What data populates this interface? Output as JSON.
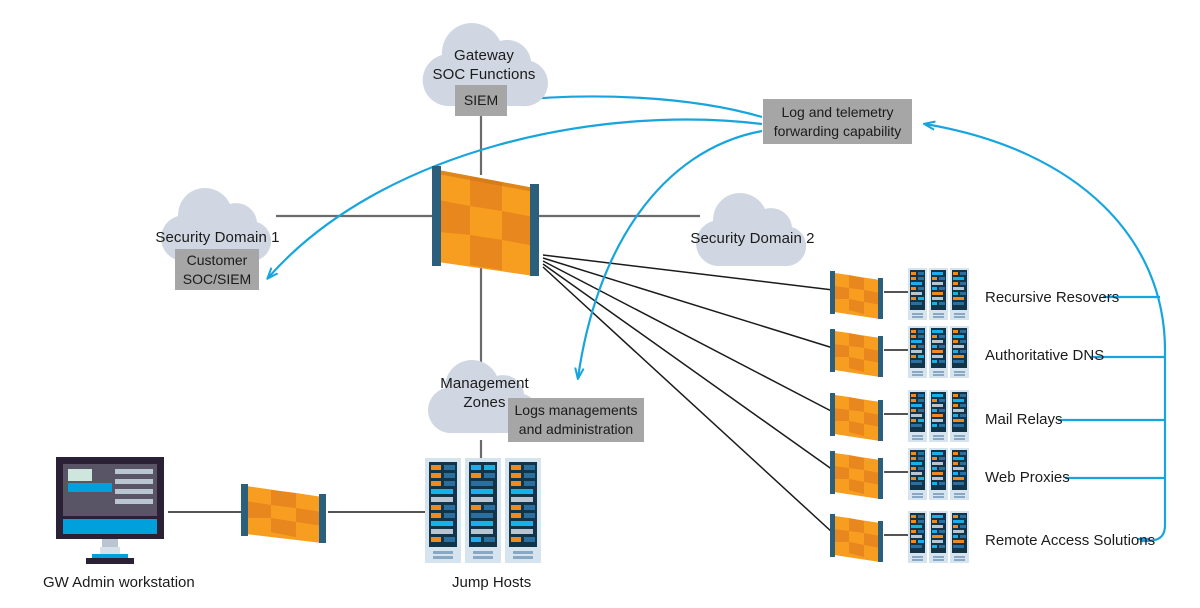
{
  "diagram": {
    "title": "Gateway security architecture diagram",
    "colors": {
      "cloud": "#d0d7e2",
      "gray_box": "#a6a6a6",
      "orange_light": "#f79e20",
      "orange_dark": "#e8871e",
      "firewall_edge": "#2b5f7c",
      "cyan": "#17a5de",
      "black_line": "#1b1b1b",
      "gray_line": "#6b6b6b",
      "rack_body": "#123449",
      "rack_frame": "#d6e4f0",
      "monitor_bezel": "#2a2136",
      "monitor_screen": "#5a5566",
      "monitor_blue": "#00a0dc"
    }
  },
  "clouds": [
    {
      "id": "gateway-soc",
      "lines": [
        "Gateway",
        "SOC Functions"
      ]
    },
    {
      "id": "security-domain-1",
      "lines": [
        "Security Domain 1"
      ]
    },
    {
      "id": "security-domain-2",
      "lines": [
        "Security Domain 2"
      ]
    },
    {
      "id": "management-zones",
      "lines": [
        "Management",
        "Zones"
      ]
    }
  ],
  "boxes": {
    "siem": {
      "label": "SIEM"
    },
    "customer_soc": {
      "line1": "Customer",
      "line2": "SOC/SIEM"
    },
    "log_forwarding": {
      "line1": "Log and telemetry",
      "line2": "forwarding capability"
    },
    "logs_management": {
      "line1": "Logs managements",
      "line2": "and administration"
    }
  },
  "services": [
    {
      "label": "Recursive Resovers"
    },
    {
      "label": "Authoritative DNS"
    },
    {
      "label": "Mail Relays"
    },
    {
      "label": "Web Proxies"
    },
    {
      "label": "Remote Access Solutions"
    }
  ],
  "device_labels": {
    "workstation": "GW Admin workstation",
    "jump_hosts": "Jump Hosts"
  },
  "icons": {
    "firewall": "firewall-icon",
    "server_rack": "server-rack-icon",
    "workstation": "workstation-icon",
    "cloud": "cloud-icon"
  }
}
